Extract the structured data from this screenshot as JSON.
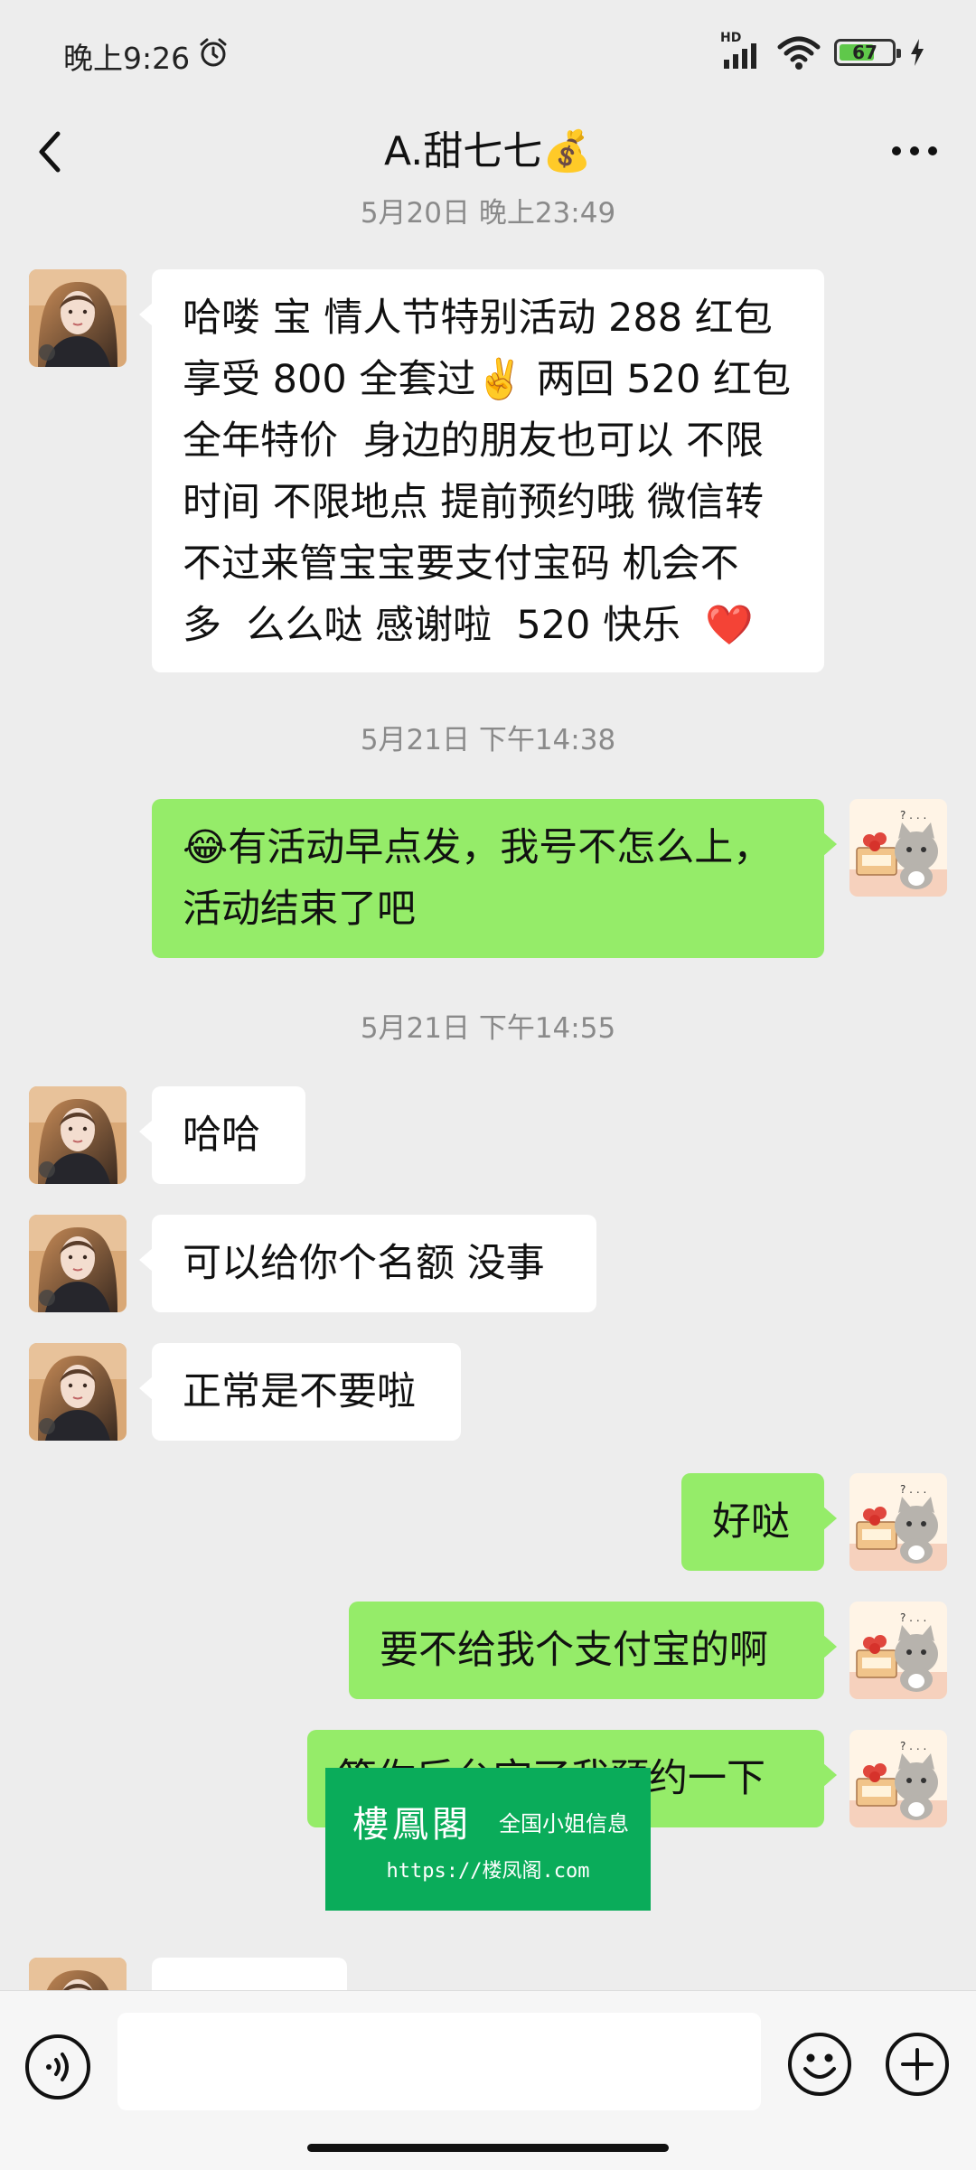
{
  "status_bar": {
    "time": "晚上9:26",
    "network": "HD",
    "battery": "67",
    "battery_level": 0.67,
    "battery_color": "#5fc84a"
  },
  "header": {
    "title": "A.甜七七💰",
    "back_icon": "chevron-left-icon",
    "more_icon": "more-dots-icon"
  },
  "messages": {
    "ts0": "5月20日 晚上23:49",
    "m1": "哈喽 宝 情人节特别活动 288 红包\n享受 800 全套过✌️ 两回 520 红包\n全年特价  身边的朋友也可以 不限\n时间 不限地点 提前预约哦 微信转\n不过来管宝宝要支付宝码 机会不\n多  么么哒 感谢啦  520 快乐  ❤️",
    "ts1": "5月21日 下午14:38",
    "m2": "😂有活动早点发，我号不怎么上，\n活动结束了吧",
    "ts2": "5月21日 下午14:55",
    "m3": "哈哈",
    "m4": "可以给你个名额 没事",
    "m5": "正常是不要啦",
    "m6": "好哒",
    "m7": "要不给我个支付宝的啊",
    "m8": "等你后台空了我预约一下"
  },
  "watermark": {
    "main": "樓鳳閣",
    "sub": "全国小姐信息",
    "url": "https://楼凤阁.com"
  },
  "input_bar": {
    "placeholder": "",
    "voice_icon": "voice-icon",
    "emoji_icon": "emoji-icon",
    "plus_icon": "plus-icon"
  },
  "colors": {
    "background": "#ededed",
    "incoming_bubble": "#ffffff",
    "outgoing_bubble": "#95ec69",
    "watermark_bg": "#0aac5a"
  }
}
